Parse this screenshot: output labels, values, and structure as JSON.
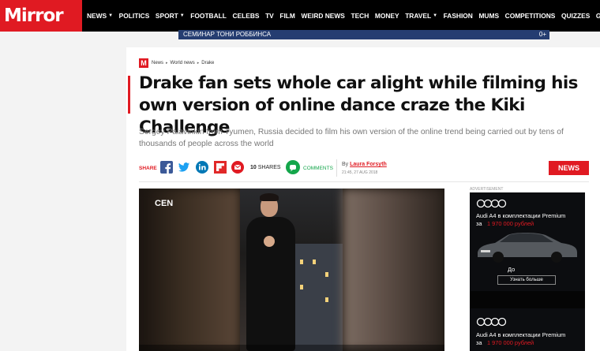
{
  "brand": {
    "logo": "Mirror",
    "accent": "#e01a22"
  },
  "nav": {
    "items": [
      {
        "label": "NEWS",
        "dropdown": true
      },
      {
        "label": "POLITICS",
        "dropdown": false
      },
      {
        "label": "SPORT",
        "dropdown": true
      },
      {
        "label": "FOOTBALL",
        "dropdown": false
      },
      {
        "label": "CELEBS",
        "dropdown": false
      },
      {
        "label": "TV",
        "dropdown": false
      },
      {
        "label": "FILM",
        "dropdown": false
      },
      {
        "label": "WEIRD NEWS",
        "dropdown": false
      },
      {
        "label": "TECH",
        "dropdown": false
      },
      {
        "label": "MONEY",
        "dropdown": false
      },
      {
        "label": "TRAVEL",
        "dropdown": true
      },
      {
        "label": "FASHION",
        "dropdown": false
      },
      {
        "label": "MUMS",
        "dropdown": false
      },
      {
        "label": "COMPETITIONS",
        "dropdown": false
      },
      {
        "label": "QUIZZES",
        "dropdown": false
      },
      {
        "label": "GOT A STORY?",
        "dropdown": false
      }
    ]
  },
  "promo": {
    "text": "СЕМИНАР ТОНИ РОББИНСА",
    "end": "0+"
  },
  "breadcrumb": {
    "logo": "M",
    "items": [
      "News",
      "World news",
      "Drake"
    ]
  },
  "article": {
    "headline": "Drake fan sets whole car alight while filming his own version of online dance craze the Kiki Challenge",
    "standfirst": "Sergey Palavinkin from Tyumen, Russia decided to film his own version of the online trend being carried out by tens of thousands of people across the world",
    "share_label": "SHARE",
    "shares_count": "10",
    "shares_word": "SHARES",
    "comments_label": "COMMENTS",
    "byline_prefix": "By",
    "author": "Laura Forsyth",
    "timestamp": "21:45, 27 AUG 2018",
    "section_badge": "NEWS"
  },
  "video": {
    "watermark": "CEN"
  },
  "ad": {
    "label": "ADVERTISEMENT",
    "headline": "Audi A4 в комплектации Premium",
    "price_prefix": "за",
    "price": "1 970 000 рублей",
    "until_prefix": "До",
    "cta": "Узнать больше",
    "icons": [
      "audi-rings-icon",
      "car-image"
    ]
  }
}
